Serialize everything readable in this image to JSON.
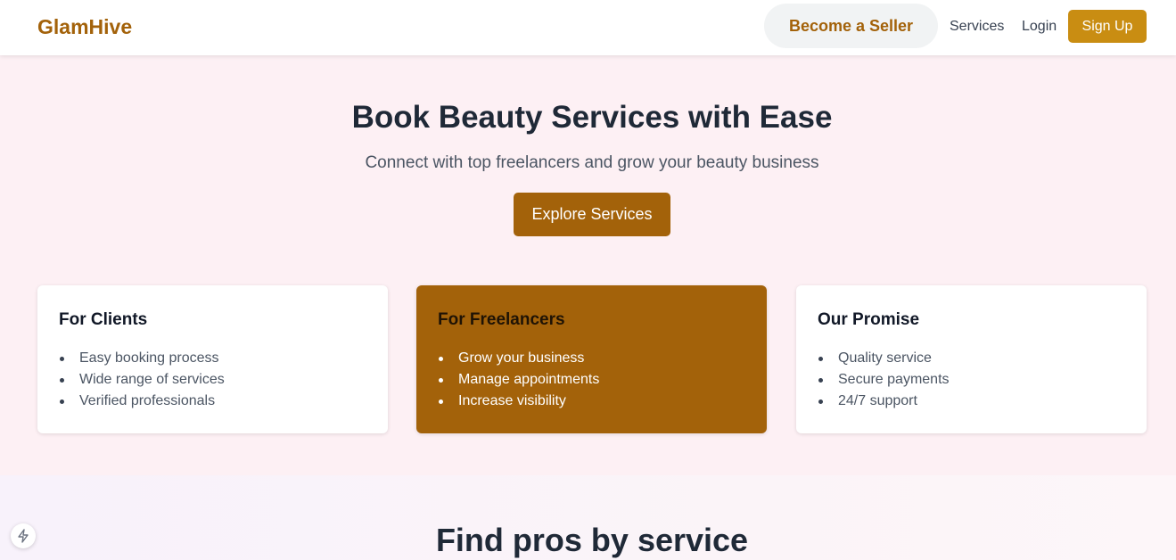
{
  "header": {
    "logo": "GlamHive",
    "become_seller": "Become a Seller",
    "services": "Services",
    "login": "Login",
    "signup": "Sign Up"
  },
  "hero": {
    "title": "Book Beauty Services with Ease",
    "subtitle": "Connect with top freelancers and grow your beauty business",
    "cta": "Explore Services"
  },
  "cards": [
    {
      "title": "For Clients",
      "items": [
        "Easy booking process",
        "Wide range of services",
        "Verified professionals"
      ]
    },
    {
      "title": "For Freelancers",
      "items": [
        "Grow your business",
        "Manage appointments",
        "Increase visibility"
      ]
    },
    {
      "title": "Our Promise",
      "items": [
        "Quality service",
        "Secure payments",
        "24/7 support"
      ]
    }
  ],
  "section2": {
    "title": "Find pros by service"
  },
  "floating": {
    "icon": "lightning-bolt-icon"
  },
  "colors": {
    "brand": "#a3620a",
    "signup": "#c98d12",
    "hero_bg": "#fdf0f4",
    "heading": "#1f2937"
  }
}
